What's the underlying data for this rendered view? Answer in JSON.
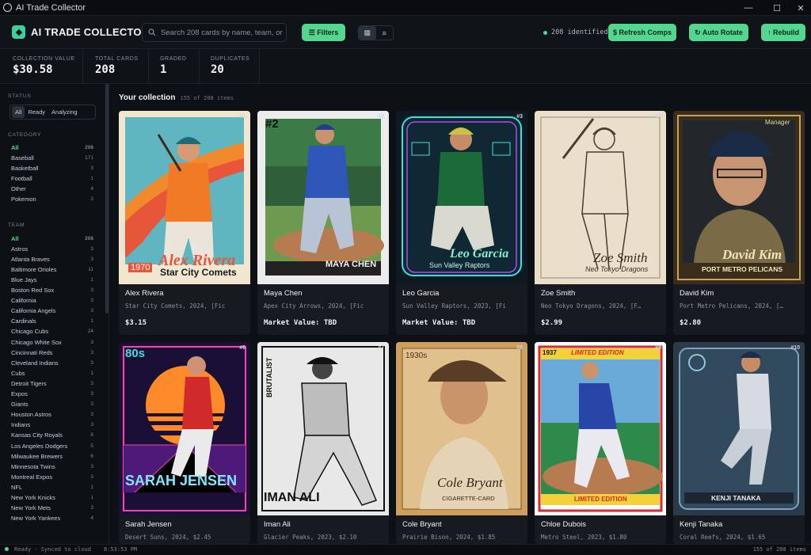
{
  "window": {
    "title": "AI Trade Collector"
  },
  "header": {
    "brand": "AI TRADE COLLECTOR",
    "search_placeholder": "Search 208 cards by name, team, or",
    "filters_label": "☰ Filters",
    "identified_text": "208 identified",
    "refresh_label": "$ Refresh Comps",
    "autorotate_label": "↻ Auto Rotate",
    "rebuild_label": "↑ Rebuild"
  },
  "stats": [
    {
      "label": "COLLECTION VALUE",
      "value": "$30.58"
    },
    {
      "label": "TOTAL CARDS",
      "value": "208"
    },
    {
      "label": "GRADED",
      "value": "1"
    },
    {
      "label": "DUPLICATES",
      "value": "20"
    }
  ],
  "sidebar": {
    "status_heading": "STATUS",
    "status_options": [
      "All",
      "Ready",
      "Analyzing"
    ],
    "category_heading": "CATEGORY",
    "categories": [
      {
        "label": "All",
        "count": "208"
      },
      {
        "label": "Baseball",
        "count": "171"
      },
      {
        "label": "Basketball",
        "count": "3"
      },
      {
        "label": "Football",
        "count": "1"
      },
      {
        "label": "Other",
        "count": "4"
      },
      {
        "label": "Pokemon",
        "count": "2"
      }
    ],
    "team_heading": "TEAM",
    "teams": [
      {
        "label": "All",
        "count": "208"
      },
      {
        "label": "Astros",
        "count": "3"
      },
      {
        "label": "Atlanta Braves",
        "count": "3"
      },
      {
        "label": "Baltimore Orioles",
        "count": "11"
      },
      {
        "label": "Blue Jays",
        "count": "1"
      },
      {
        "label": "Boston Red Sox",
        "count": "3"
      },
      {
        "label": "California",
        "count": "3"
      },
      {
        "label": "California Angels",
        "count": "3"
      },
      {
        "label": "Cardinals",
        "count": "1"
      },
      {
        "label": "Chicago Cubs",
        "count": "24"
      },
      {
        "label": "Chicago White Sox",
        "count": "3"
      },
      {
        "label": "Cincinnati Reds",
        "count": "3"
      },
      {
        "label": "Cleveland Indians",
        "count": "3"
      },
      {
        "label": "Cubs",
        "count": "1"
      },
      {
        "label": "Detroit Tigers",
        "count": "3"
      },
      {
        "label": "Expos",
        "count": "3"
      },
      {
        "label": "Giants",
        "count": "3"
      },
      {
        "label": "Houston Astros",
        "count": "3"
      },
      {
        "label": "Indians",
        "count": "3"
      },
      {
        "label": "Kansas City Royals",
        "count": "6"
      },
      {
        "label": "Los Angeles Dodgers",
        "count": "5"
      },
      {
        "label": "Milwaukee Brewers",
        "count": "6"
      },
      {
        "label": "Minnesota Twins",
        "count": "3"
      },
      {
        "label": "Montreal Expos",
        "count": "3"
      },
      {
        "label": "NFL",
        "count": "1"
      },
      {
        "label": "New York Knicks",
        "count": "1"
      },
      {
        "label": "New York Mets",
        "count": "3"
      },
      {
        "label": "New York Yankees",
        "count": "4"
      }
    ]
  },
  "main": {
    "title": "Your collection",
    "subtitle": "155 of 208 items"
  },
  "cards": [
    {
      "name": "Alex Rivera",
      "meta": "Star City Comets, 2024, [Fic",
      "price": "$3.15",
      "num": "#1",
      "art_name": "Alex Rivera",
      "art_team": "Star City Comets",
      "art_year": "1970"
    },
    {
      "name": "Maya Chen",
      "meta": "Apex City Arrows, 2024, [Fic",
      "price": "Market Value: TBD",
      "num": "#2",
      "art_name": "MAYA CHEN",
      "art_team": "",
      "art_year": "#2"
    },
    {
      "name": "Leo Garcia",
      "meta": "Sun Valley Raptors, 2023, [Fi",
      "price": "Market Value: TBD",
      "num": "#3",
      "art_name": "Leo Garcia",
      "art_team": "Sun Valley Raptors",
      "art_year": ""
    },
    {
      "name": "Zoe Smith",
      "meta": "Neo Tokyo Dragons, 2024, [F…",
      "price": "$2.99",
      "num": "#4",
      "art_name": "Zoe Smith",
      "art_team": "Neo Tokyo Dragons",
      "art_year": ""
    },
    {
      "name": "David Kim",
      "meta": "Port Metro Pelicans, 2024, […",
      "price": "$2.80",
      "num": "Manager",
      "art_name": "David Kim",
      "art_team": "PORT METRO PELICANS",
      "art_year": ""
    },
    {
      "name": "Sarah Jensen",
      "meta": "Desert Suns, 2024, $2.45",
      "price": "",
      "num": "#6",
      "art_name": "SARAH JENSEN",
      "art_team": "",
      "art_year": "80s"
    },
    {
      "name": "Iman Ali",
      "meta": "Glacier Peaks, 2023, $2.10",
      "price": "",
      "num": "#7",
      "art_name": "IMAN ALI",
      "art_team": "BRUTALIST",
      "art_year": ""
    },
    {
      "name": "Cole Bryant",
      "meta": "Prairie Bison, 2024, $1.85",
      "price": "",
      "num": "#8",
      "art_name": "Cole Bryant",
      "art_team": "CIGARETTE-CARD",
      "art_year": "1930s"
    },
    {
      "name": "Chloe Dubois",
      "meta": "Metro Steel, 2023, $1.80",
      "price": "",
      "num": "#9",
      "art_name": "LIMITED EDITION",
      "art_team": "LIMITED EDITION",
      "art_year": "1937"
    },
    {
      "name": "Kenji Tanaka",
      "meta": "Coral Reefs, 2024, $1.65",
      "price": "",
      "num": "#10",
      "art_name": "KENJI TANAKA",
      "art_team": "",
      "art_year": ""
    }
  ],
  "statusbar": {
    "left": "Ready · Synced to cloud",
    "time": "8:53:53 PM",
    "right": "155 of 208 items"
  }
}
